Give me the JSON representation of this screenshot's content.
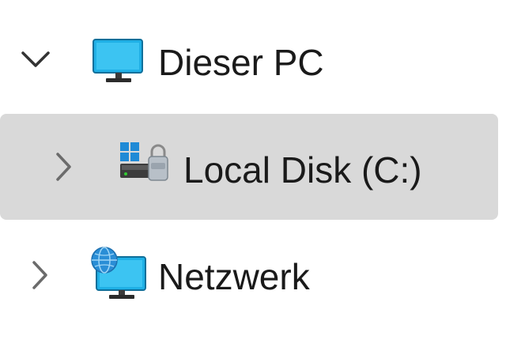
{
  "nav_tree": {
    "items": [
      {
        "label": "Dieser PC",
        "expanded": true,
        "icon": "monitor-icon"
      },
      {
        "label": "Local Disk (C:)",
        "expanded": false,
        "selected": true,
        "icon": "drive-icon"
      },
      {
        "label": "Netzwerk",
        "expanded": false,
        "icon": "network-icon"
      }
    ]
  },
  "colors": {
    "selection_bg": "#d9d9d9",
    "text": "#1a1a1a",
    "chevron": "#333333",
    "chevron_muted": "#6b6b6b",
    "monitor_screen": "#1fb0e6"
  }
}
